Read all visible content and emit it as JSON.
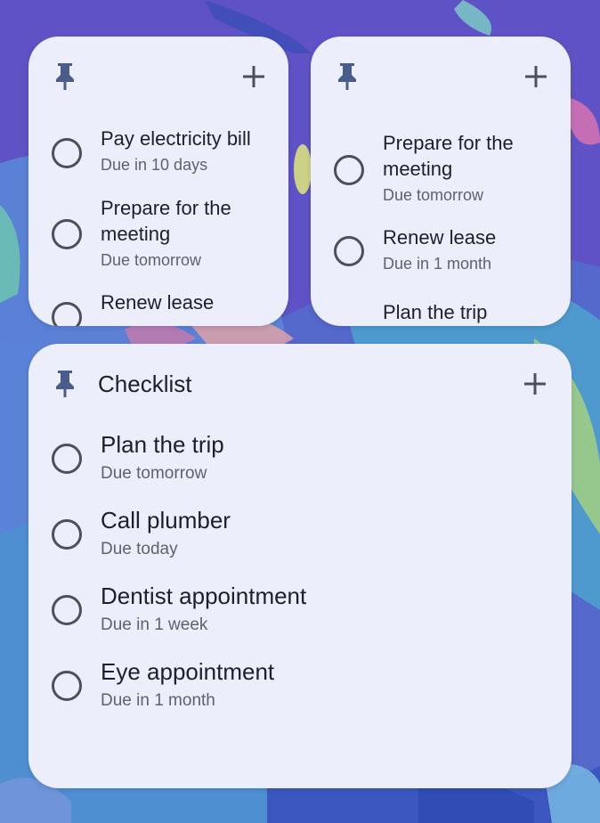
{
  "colors": {
    "widget_bg": "#eceffb",
    "text_primary": "#1d1f2b",
    "text_secondary": "#5d6170",
    "icon": "#4c505e",
    "wallpaper_base": "#4f63c8"
  },
  "icons": {
    "pin": "pin-icon",
    "add": "plus-icon",
    "checkbox": "circle-checkbox"
  },
  "widget_small_left": {
    "tasks": [
      {
        "name": "Pay electricity bill",
        "due": "Due in 10 days"
      },
      {
        "name": "Prepare for the meeting",
        "due": "Due tomorrow"
      },
      {
        "name": "Renew lease",
        "due": ""
      }
    ]
  },
  "widget_small_right": {
    "tasks": [
      {
        "name": "Prepare for the meeting",
        "due": "Due tomorrow"
      },
      {
        "name": "Renew lease",
        "due": "Due in 1 month"
      },
      {
        "name": "Plan the trip",
        "due": ""
      }
    ]
  },
  "widget_checklist": {
    "title": "Checklist",
    "tasks": [
      {
        "name": "Plan the trip",
        "due": "Due tomorrow"
      },
      {
        "name": "Call plumber",
        "due": "Due today"
      },
      {
        "name": "Dentist appointment",
        "due": "Due in 1 week"
      },
      {
        "name": "Eye appointment",
        "due": "Due in 1 month"
      }
    ]
  }
}
